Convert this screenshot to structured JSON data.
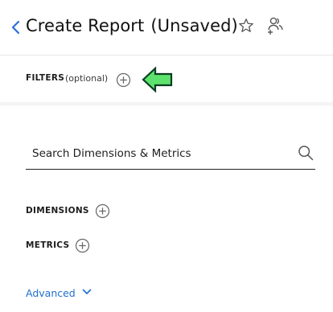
{
  "header": {
    "title": "Create Report",
    "status": "(Unsaved)",
    "back_icon": "chevron-left-icon",
    "favorite_icon": "star-outline-icon",
    "share_icon": "users-share-icon"
  },
  "filters": {
    "label": "FILTERS",
    "optional_label": "(optional)",
    "add_icon": "plus-circle-icon",
    "pointer_icon": "left-arrow-icon",
    "pointer_color": "#5ce26d"
  },
  "search": {
    "placeholder": "Search Dimensions & Metrics",
    "value": "",
    "icon": "search-icon"
  },
  "dimensions": {
    "label": "DIMENSIONS",
    "add_icon": "plus-circle-icon"
  },
  "metrics": {
    "label": "METRICS",
    "add_icon": "plus-circle-icon"
  },
  "advanced": {
    "label": "Advanced",
    "icon": "chevron-down-icon"
  },
  "colors": {
    "link": "#1f6fd1",
    "text": "#1d1d1f",
    "pointer_outline": "#0c3d22"
  }
}
